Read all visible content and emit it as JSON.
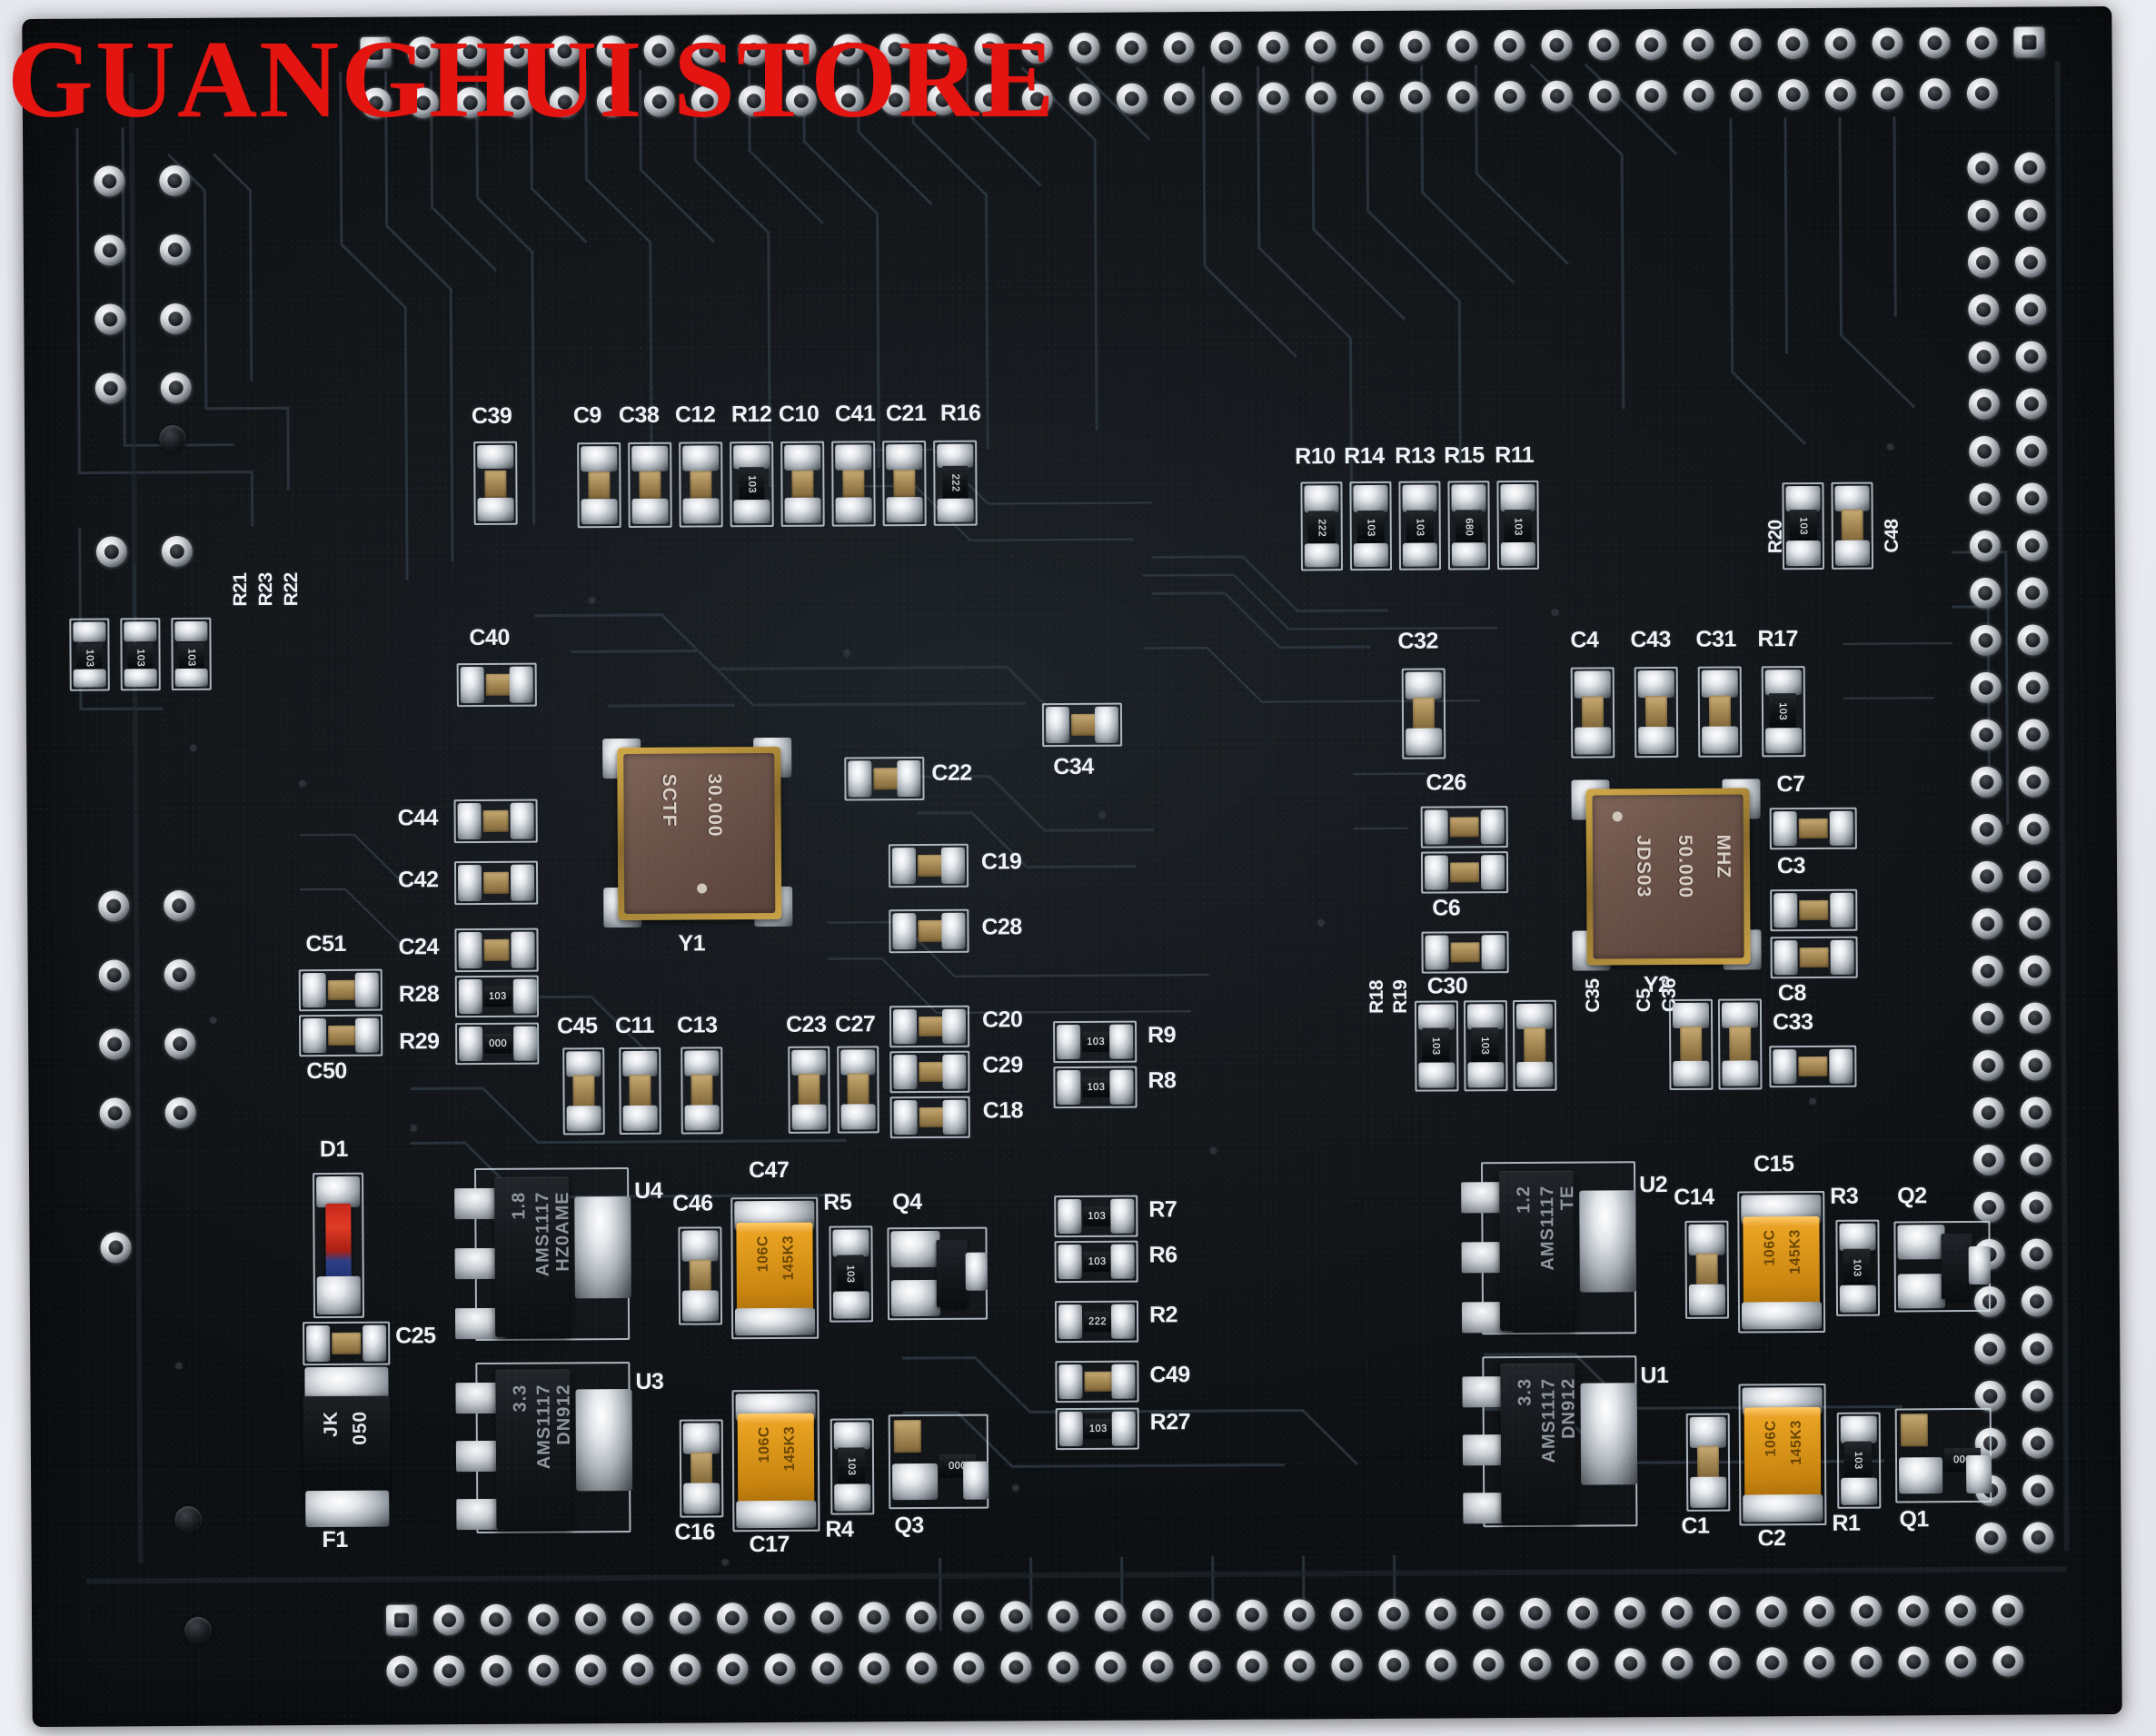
{
  "watermark": {
    "text": "GUANGHUI STORE",
    "color": "#e41410"
  },
  "board": {
    "color": "#14181c",
    "silkscreen_color": "#eef3f8",
    "description": "FPGA / MCU core board, black solder mask, dual 0.1in pin headers"
  },
  "oscillators": [
    {
      "ref": "Y1",
      "line1": "SCTF",
      "line2": "30.000",
      "line3": ""
    },
    {
      "ref": "Y2",
      "line1": "JDS03",
      "line2": "50.000",
      "line3": "MHZ"
    }
  ],
  "regulators": [
    {
      "ref": "U4",
      "line1": "AMS1117",
      "line2": "1.8",
      "line3": "HZ0AME"
    },
    {
      "ref": "U3",
      "line1": "AMS1117",
      "line2": "3.3",
      "line3": "DN912"
    },
    {
      "ref": "U2",
      "line1": "AMS1117",
      "line2": "1.2",
      "line3": "TE"
    },
    {
      "ref": "U1",
      "line1": "AMS1117",
      "line2": "3.3",
      "line3": "DN912"
    }
  ],
  "tantalums": [
    {
      "ref": "C47",
      "line1": "106C",
      "line2": "145K3"
    },
    {
      "ref": "C17",
      "line1": "106C",
      "line2": "145K3"
    },
    {
      "ref": "C15",
      "line1": "106C",
      "line2": "145K3"
    },
    {
      "ref": "C2",
      "line1": "106C",
      "line2": "145K3"
    }
  ],
  "fuse": {
    "ref": "F1",
    "line1": "JK",
    "line2": "050"
  },
  "diode": {
    "ref": "D1"
  },
  "transistors": [
    {
      "ref": "Q4"
    },
    {
      "ref": "Q3"
    },
    {
      "ref": "Q2"
    },
    {
      "ref": "Q1"
    }
  ],
  "top_cap_row": {
    "single": {
      "ref": "C39"
    },
    "group": [
      {
        "ref": "C9",
        "type": "cap"
      },
      {
        "ref": "C38",
        "type": "cap"
      },
      {
        "ref": "C12",
        "type": "cap"
      },
      {
        "ref": "R12",
        "type": "res",
        "code": "103"
      },
      {
        "ref": "C10",
        "type": "cap"
      },
      {
        "ref": "C41",
        "type": "cap"
      },
      {
        "ref": "C21",
        "type": "cap"
      },
      {
        "ref": "R16",
        "type": "res",
        "code": "222"
      }
    ]
  },
  "top_right_res_row": [
    {
      "ref": "R10",
      "code": "222"
    },
    {
      "ref": "R14",
      "code": "103"
    },
    {
      "ref": "R13",
      "code": "103"
    },
    {
      "ref": "R15",
      "code": "680"
    },
    {
      "ref": "R11",
      "code": "103"
    }
  ],
  "upper_right_pair": [
    {
      "ref": "R20",
      "code": "103",
      "type": "res"
    },
    {
      "ref": "C48",
      "type": "cap"
    }
  ],
  "left_res_group": [
    {
      "ref": "R22",
      "code": "103"
    },
    {
      "ref": "R23",
      "code": "103"
    },
    {
      "ref": "R21",
      "code": "103"
    }
  ],
  "left_column": [
    {
      "ref": "C40",
      "type": "cap"
    },
    {
      "ref": "C44",
      "type": "cap"
    },
    {
      "ref": "C42",
      "type": "cap"
    },
    {
      "ref": "C24",
      "type": "cap"
    },
    {
      "ref": "R28",
      "type": "res",
      "code": "103"
    },
    {
      "ref": "R29",
      "type": "res",
      "code": "000"
    },
    {
      "ref": "C51",
      "type": "cap"
    },
    {
      "ref": "C50",
      "type": "cap"
    },
    {
      "ref": "C25",
      "type": "cap"
    }
  ],
  "center_column": [
    {
      "ref": "C22",
      "type": "cap"
    },
    {
      "ref": "C34",
      "type": "cap"
    },
    {
      "ref": "C19",
      "type": "cap"
    },
    {
      "ref": "C28",
      "type": "cap"
    },
    {
      "ref": "C20",
      "type": "cap"
    },
    {
      "ref": "C29",
      "type": "cap"
    },
    {
      "ref": "C18",
      "type": "cap"
    },
    {
      "ref": "C23",
      "type": "cap"
    },
    {
      "ref": "C27",
      "type": "cap"
    },
    {
      "ref": "C45",
      "type": "cap"
    },
    {
      "ref": "C11",
      "type": "cap"
    },
    {
      "ref": "C13",
      "type": "cap"
    }
  ],
  "center_res_column": [
    {
      "ref": "R9",
      "code": "103"
    },
    {
      "ref": "R8",
      "code": "103"
    },
    {
      "ref": "R7",
      "code": "103"
    },
    {
      "ref": "R6",
      "code": "103"
    },
    {
      "ref": "R2",
      "code": "222"
    },
    {
      "ref": "C49",
      "code": ""
    },
    {
      "ref": "R27",
      "code": "103"
    }
  ],
  "right_cluster": [
    {
      "ref": "C32",
      "type": "cap"
    },
    {
      "ref": "C4",
      "type": "cap"
    },
    {
      "ref": "C43",
      "type": "cap"
    },
    {
      "ref": "C31",
      "type": "cap"
    },
    {
      "ref": "R17",
      "type": "res",
      "code": "103"
    },
    {
      "ref": "C26",
      "type": "cap"
    },
    {
      "ref": "C6",
      "type": "cap"
    },
    {
      "ref": "C30",
      "type": "cap"
    },
    {
      "ref": "C7",
      "type": "cap"
    },
    {
      "ref": "C3",
      "type": "cap"
    },
    {
      "ref": "C8",
      "type": "cap"
    },
    {
      "ref": "R19",
      "type": "res",
      "code": "103"
    },
    {
      "ref": "R18",
      "type": "res",
      "code": "103"
    },
    {
      "ref": "C35",
      "type": "cap"
    },
    {
      "ref": "C5",
      "type": "cap"
    },
    {
      "ref": "C36",
      "type": "cap"
    },
    {
      "ref": "C33",
      "type": "cap"
    }
  ],
  "regulator_support": [
    {
      "ref": "C46",
      "type": "cap"
    },
    {
      "ref": "R5",
      "type": "res",
      "code": "103"
    },
    {
      "ref": "C16",
      "type": "cap"
    },
    {
      "ref": "R4",
      "type": "res",
      "code": "103"
    },
    {
      "ref": "C14",
      "type": "cap"
    },
    {
      "ref": "R3",
      "type": "res",
      "code": "103"
    },
    {
      "ref": "C1",
      "type": "cap"
    },
    {
      "ref": "R1",
      "type": "res",
      "code": "103"
    }
  ],
  "headers": {
    "top_label": "top pin header",
    "right_label": "right pin header",
    "bottom_label": "bottom pin header"
  }
}
